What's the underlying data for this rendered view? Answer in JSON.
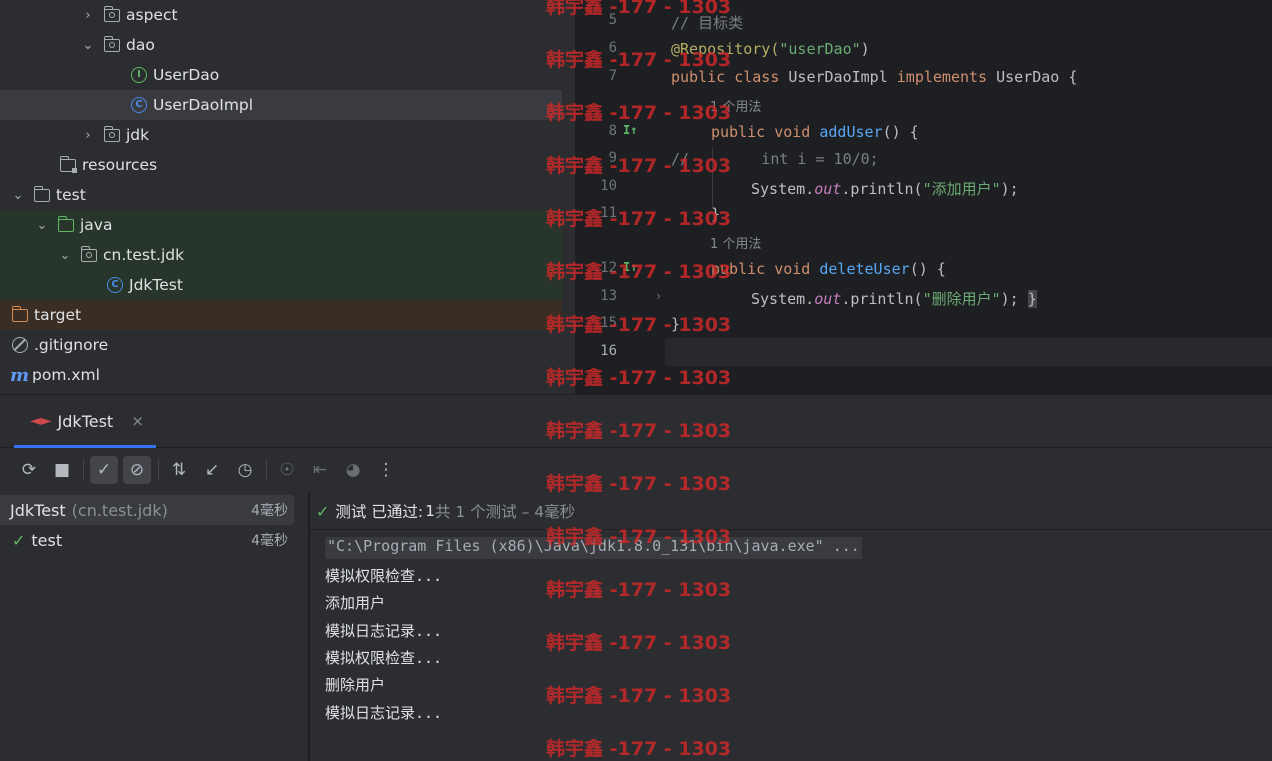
{
  "tree": {
    "items": [
      {
        "label": "aspect",
        "kind": "package"
      },
      {
        "label": "dao",
        "kind": "package"
      },
      {
        "label": "UserDao",
        "kind": "interface"
      },
      {
        "label": "UserDaoImpl",
        "kind": "class"
      },
      {
        "label": "jdk",
        "kind": "package"
      },
      {
        "label": "resources",
        "kind": "resources"
      },
      {
        "label": "test",
        "kind": "folder"
      },
      {
        "label": "java",
        "kind": "test-root"
      },
      {
        "label": "cn.test.jdk",
        "kind": "package"
      },
      {
        "label": "JdkTest",
        "kind": "class"
      },
      {
        "label": "target",
        "kind": "excluded"
      },
      {
        "label": ".gitignore",
        "kind": "ignore"
      },
      {
        "label": "pom.xml",
        "kind": "maven"
      }
    ]
  },
  "editor": {
    "line_numbers": [
      "5",
      "6",
      "7",
      "8",
      "9",
      "10",
      "11",
      "12",
      "13",
      "15",
      "16"
    ],
    "hint_usage": "1 个用法",
    "lines": {
      "l5": "// 目标类",
      "l6_ann": "@Repository(",
      "l6_str": "\"userDao\"",
      "l6_end": ")",
      "l7_kw1": "public class ",
      "l7_name": "UserDaoImpl ",
      "l7_kw2": "implements ",
      "l7_rest": "UserDao {",
      "l8_kw": "public void ",
      "l8_fn": "addUser",
      "l8_rest": "() {",
      "l9": "//        int i = 10/0;",
      "l10_pre": "System.",
      "l10_fld": "out",
      "l10_mid": ".println(",
      "l10_str": "\"添加用户\"",
      "l10_end": ");",
      "l11": "}",
      "l12_kw": "public void ",
      "l12_fn": "deleteUser",
      "l12_rest": "() {",
      "l13_pre": "System.",
      "l13_fld": "out",
      "l13_mid": ".println(",
      "l13_str": "\"删除用户\"",
      "l13_end": ");",
      "l13_brace": "}",
      "l15": "}"
    }
  },
  "run": {
    "tab_label": "JdkTest",
    "tab_close": "×",
    "tests": [
      {
        "name": "JdkTest",
        "pkg": "(cn.test.jdk)",
        "time": "4毫秒"
      },
      {
        "name": "test",
        "time": "4毫秒"
      }
    ],
    "status": {
      "passed_label": "测试 已通过: ",
      "passed_count": "1",
      "extra": "共 1 个测试 – 4毫秒"
    },
    "console": [
      "\"C:\\Program Files (x86)\\Java\\jdk1.8.0_131\\bin\\java.exe\" ...",
      "模拟权限检查...",
      "添加用户",
      "模拟日志记录...",
      "模拟权限检查...",
      "删除用户",
      "模拟日志记录..."
    ]
  },
  "watermark": "韩宇鑫 -177 - 1303",
  "colors": {
    "accent": "#3574f0",
    "pass": "#5fb865",
    "keyword": "#cf8e6d",
    "string": "#6aab73",
    "annotation": "#b3ae60",
    "watermark": "#d22828"
  }
}
